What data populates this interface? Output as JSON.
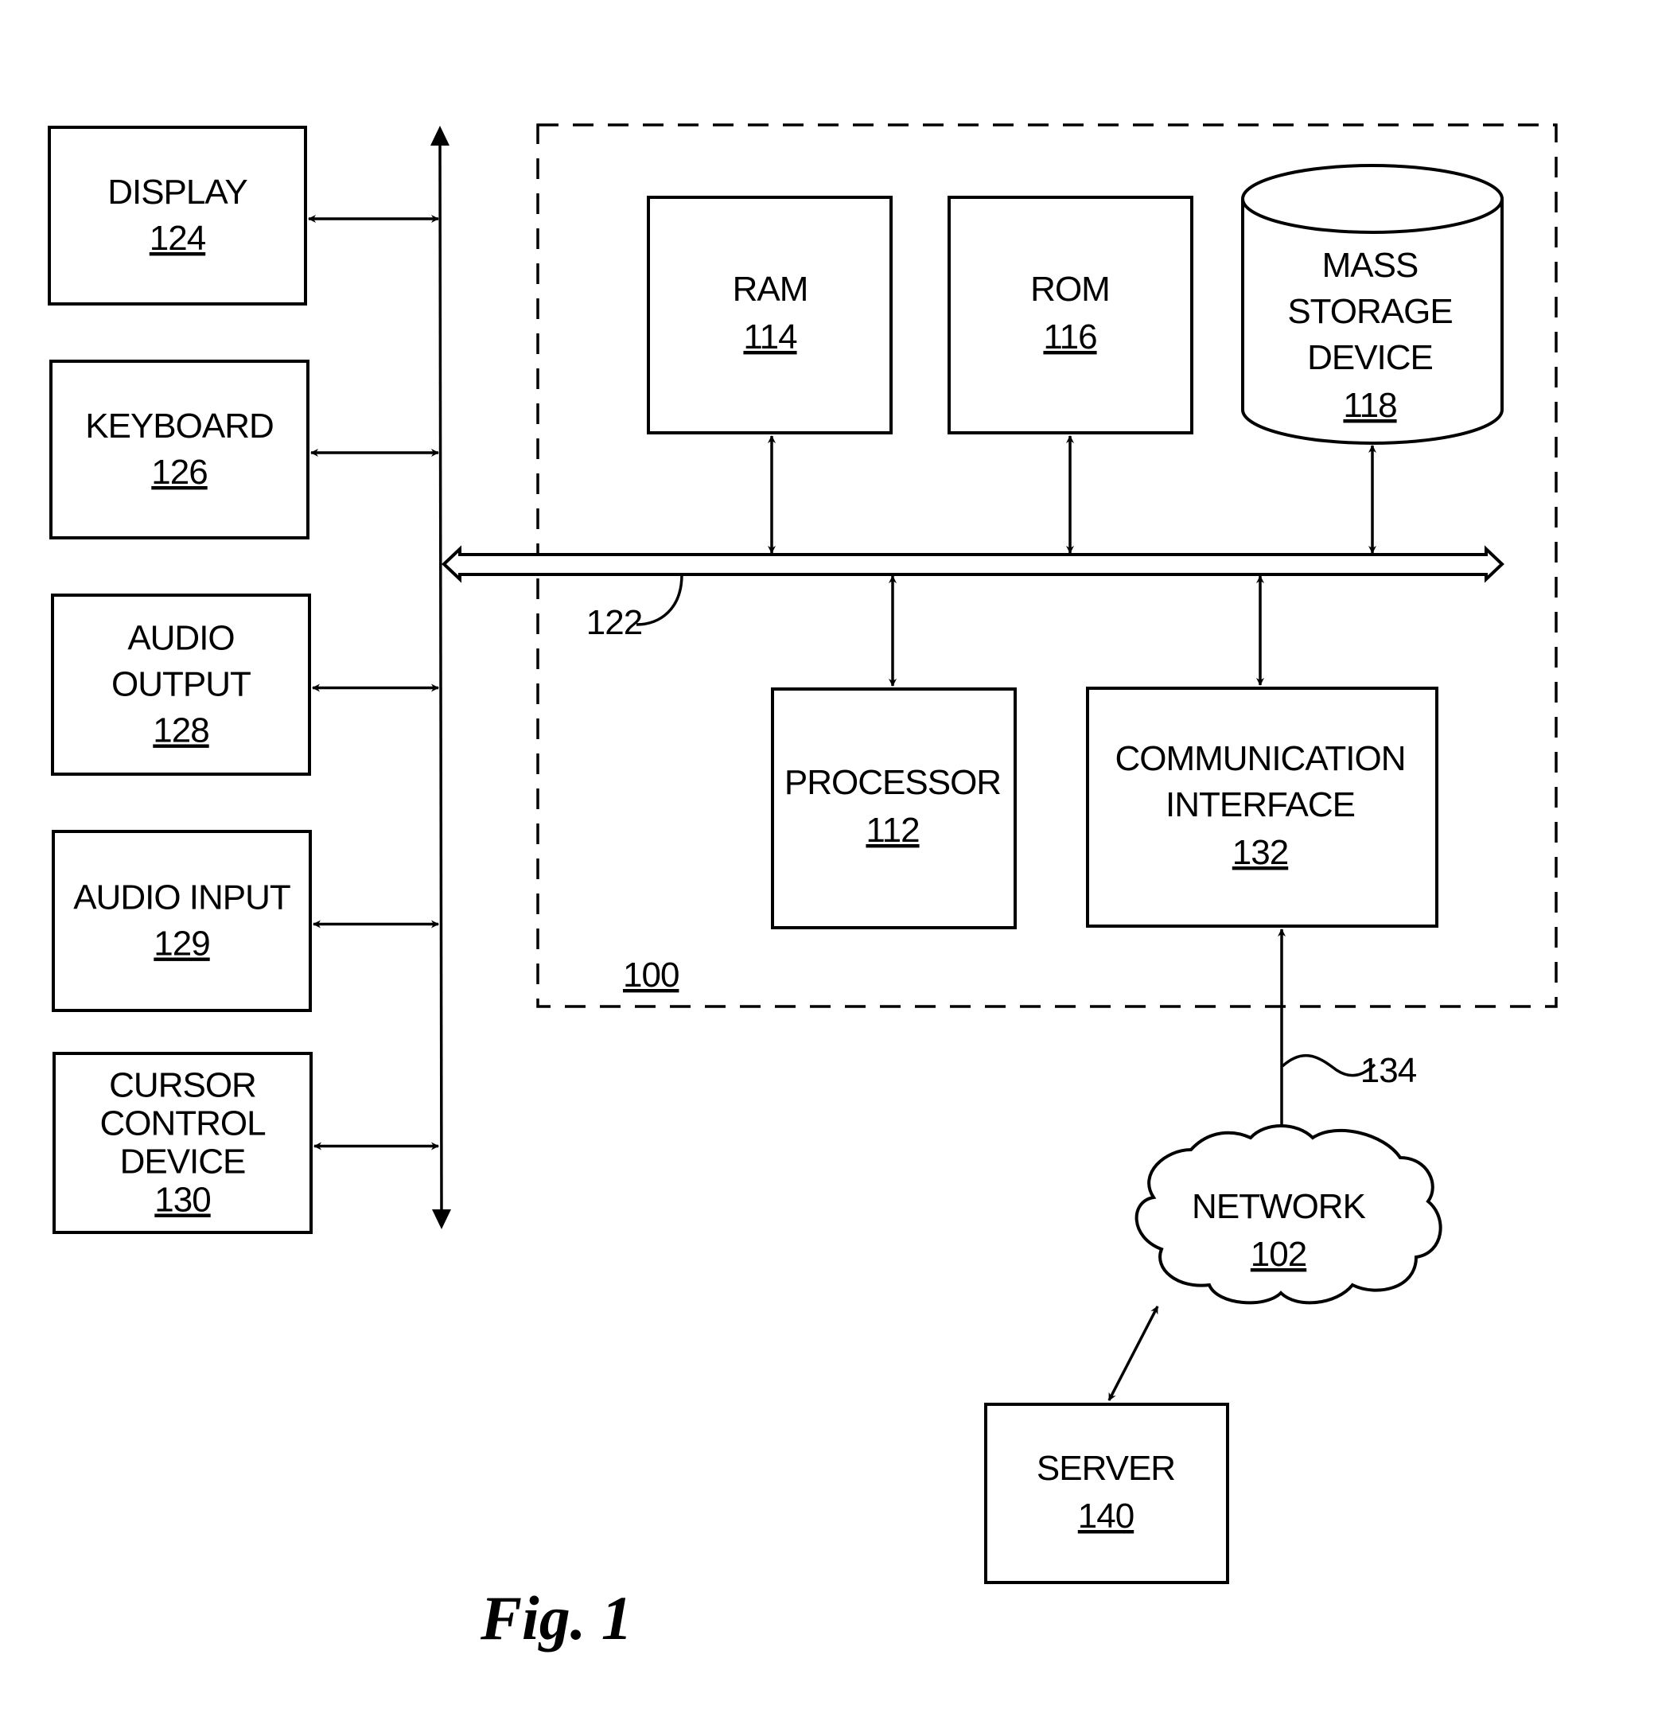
{
  "figure_label": "Fig. 1",
  "system": {
    "ref": "100"
  },
  "bus": {
    "ref": "122"
  },
  "link": {
    "ref": "134"
  },
  "peripherals": [
    {
      "id": "display",
      "lines": [
        "DISPLAY"
      ],
      "ref": "124"
    },
    {
      "id": "keyboard",
      "lines": [
        "KEYBOARD"
      ],
      "ref": "126"
    },
    {
      "id": "audio-output",
      "lines": [
        "AUDIO",
        "OUTPUT"
      ],
      "ref": "128"
    },
    {
      "id": "audio-input",
      "lines": [
        "AUDIO INPUT"
      ],
      "ref": "129"
    },
    {
      "id": "cursor-control-device",
      "lines": [
        "CURSOR",
        "CONTROL",
        "DEVICE"
      ],
      "ref": "130"
    }
  ],
  "components": {
    "ram": {
      "lines": [
        "RAM"
      ],
      "ref": "114"
    },
    "rom": {
      "lines": [
        "ROM"
      ],
      "ref": "116"
    },
    "mass_storage": {
      "lines": [
        "MASS",
        "STORAGE",
        "DEVICE"
      ],
      "ref": "118"
    },
    "processor": {
      "lines": [
        "PROCESSOR"
      ],
      "ref": "112"
    },
    "communication_interface": {
      "lines": [
        "COMMUNICATION",
        "INTERFACE"
      ],
      "ref": "132"
    }
  },
  "network": {
    "lines": [
      "NETWORK"
    ],
    "ref": "102"
  },
  "server": {
    "lines": [
      "SERVER"
    ],
    "ref": "140"
  }
}
